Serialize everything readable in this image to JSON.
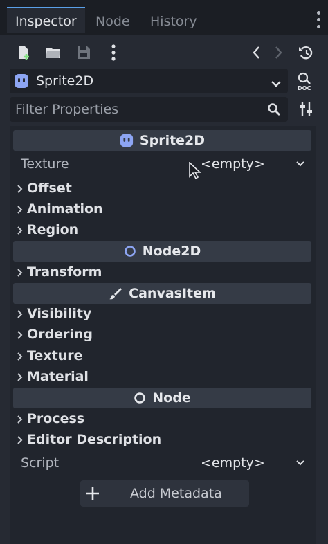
{
  "tabs": [
    {
      "label": "Inspector",
      "active": true
    },
    {
      "label": "Node",
      "active": false
    },
    {
      "label": "History",
      "active": false
    }
  ],
  "toolbar": {
    "icons": [
      "new-resource-icon",
      "open-folder-icon",
      "save-icon",
      "more-options-icon",
      "back-icon",
      "forward-icon",
      "history-icon"
    ]
  },
  "object_selector": {
    "label": "Sprite2D",
    "icon": "sprite2d-icon"
  },
  "filter": {
    "placeholder": "Filter Properties"
  },
  "sections": {
    "sprite2d": "Sprite2D",
    "node2d": "Node2D",
    "canvasitem": "CanvasItem",
    "node": "Node"
  },
  "properties": {
    "texture": {
      "label": "Texture",
      "value": "<empty>"
    },
    "script": {
      "label": "Script",
      "value": "<empty>"
    }
  },
  "groups": {
    "offset": "Offset",
    "animation": "Animation",
    "region": "Region",
    "transform": "Transform",
    "visibility": "Visibility",
    "ordering": "Ordering",
    "texture": "Texture",
    "material": "Material",
    "process": "Process",
    "editor_description": "Editor Description"
  },
  "add_metadata": "Add Metadata",
  "colors": {
    "accent": "#5aa0e8",
    "sprite_icon": "#8da5f3",
    "node2d_icon": "#8da5f3",
    "panel": "#262a33",
    "section_header": "#353b46"
  }
}
